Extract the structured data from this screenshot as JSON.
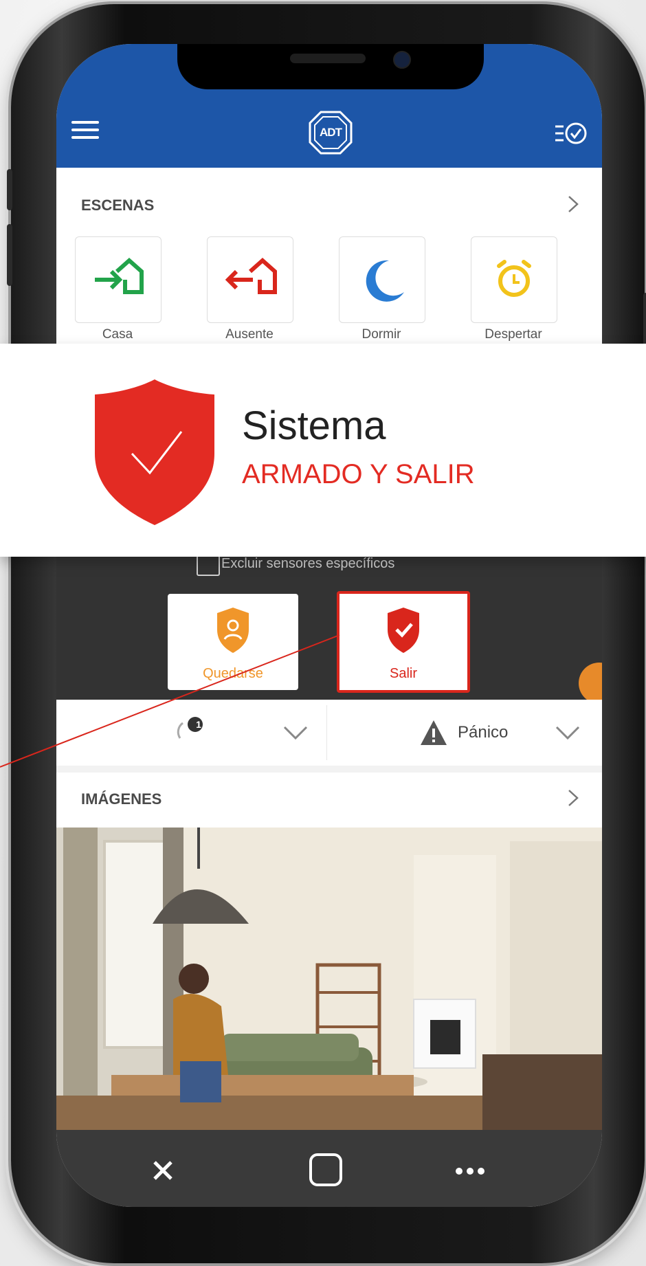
{
  "header": {
    "menu_icon": "hamburger-menu-icon",
    "logo_text": "ADT",
    "history_icon": "checklist-history-icon",
    "brand_color": "#1d56a8"
  },
  "scenes": {
    "title": "ESCENAS",
    "items": [
      {
        "label": "Casa",
        "icon": "home-enter-icon",
        "color": "#22a34a"
      },
      {
        "label": "Ausente",
        "icon": "home-exit-icon",
        "color": "#d9261c"
      },
      {
        "label": "Dormir",
        "icon": "moon-icon",
        "color": "#2a7cd3"
      },
      {
        "label": "Despertar",
        "icon": "alarm-clock-icon",
        "color": "#f2c31b"
      }
    ]
  },
  "system_status": {
    "title": "Sistema",
    "status": "ARMADO Y SALIR",
    "icon": "shield-check-icon",
    "status_color": "#e32b23"
  },
  "arming": {
    "exclude_label": "Excluir sensores específicos",
    "modes": [
      {
        "label": "Quedarse",
        "icon": "shield-person-icon",
        "color": "#f0962a"
      },
      {
        "label": "Salir",
        "icon": "shield-check-icon",
        "color": "#d9261c",
        "selected": true
      }
    ]
  },
  "actions": {
    "badge_count": "1",
    "panic_label": "Pánico",
    "panic_icon": "warning-triangle-icon"
  },
  "images": {
    "title": "IMÁGENES"
  },
  "navbar": {
    "close_icon": "close-icon",
    "home_icon": "square-home-icon",
    "more_icon": "more-dots-icon"
  }
}
